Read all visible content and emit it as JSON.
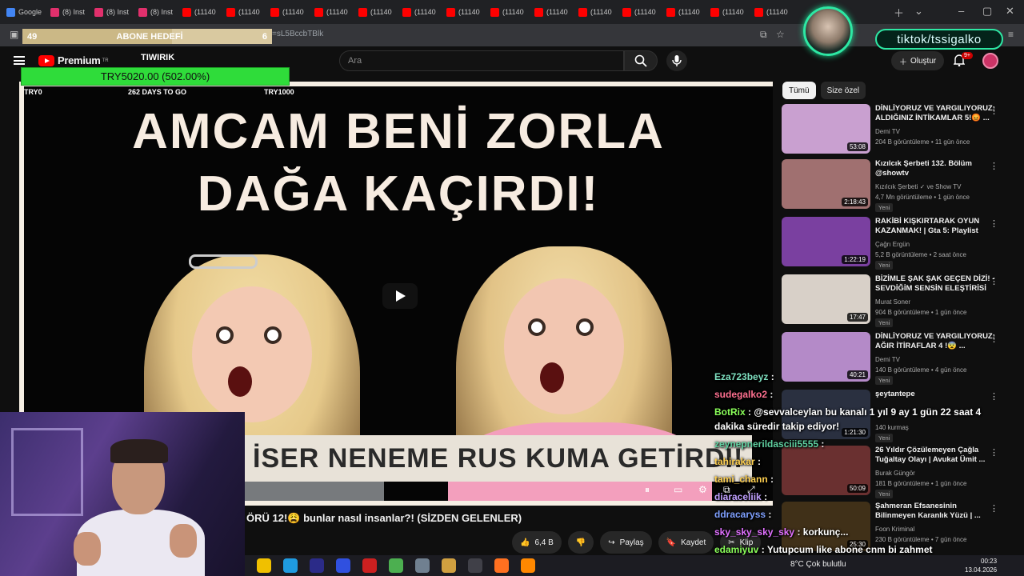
{
  "browser": {
    "tabs": [
      {
        "label": "Google",
        "color": "#4285f4"
      },
      {
        "label": "(8) Inst",
        "color": "#e1306c"
      },
      {
        "label": "(8) Inst",
        "color": "#e1306c"
      },
      {
        "label": "(8) Inst",
        "color": "#e1306c"
      },
      {
        "label": "(11140",
        "color": "#ff0000"
      },
      {
        "label": "(11140",
        "color": "#ff0000"
      },
      {
        "label": "(11140",
        "color": "#ff0000"
      },
      {
        "label": "(11140",
        "color": "#ff0000"
      },
      {
        "label": "(11140",
        "color": "#ff0000"
      },
      {
        "label": "(11140",
        "color": "#ff0000"
      },
      {
        "label": "(11140",
        "color": "#ff0000"
      },
      {
        "label": "(11140",
        "color": "#ff0000"
      },
      {
        "label": "(11140",
        "color": "#ff0000"
      },
      {
        "label": "(11140",
        "color": "#ff0000"
      },
      {
        "label": "(11140",
        "color": "#ff0000"
      },
      {
        "label": "(11140",
        "color": "#ff0000"
      },
      {
        "label": "(11140",
        "color": "#ff0000"
      },
      {
        "label": "(11140",
        "color": "#ff0000"
      }
    ],
    "url": "=sL5BccbTBlk"
  },
  "overlay": {
    "subgoal_left": "49",
    "subgoal_label": "ABONE HEDEFİ",
    "subgoal_right": "6",
    "subgoal_progress": 0.6,
    "brand": "TIWIRIK",
    "fund": "TRY5020.00 (502.00%)",
    "fund_left": "TRY0",
    "fund_days": "262 DAYS TO GO",
    "fund_right": "TRY1000",
    "tiktok": "tiktok/tssigalko"
  },
  "youtube": {
    "logo": "Premium",
    "region": "TR",
    "search_placeholder": "Ara",
    "create_label": "Oluştur",
    "notif_badge": "9+",
    "video": {
      "thumb_title_line1": "AMCAM BENİ ZORLA",
      "thumb_title_line2": "DAĞA KAÇIRDI!",
      "banner": "İSER NENEME RUS KUMA GETİRDİ!",
      "title": "ÖRÜ 12!😩 bunlar nasıl insanlar?! (SİZDEN GELENLER)",
      "likes": "6,4 B",
      "share": "Paylaş",
      "save": "Kaydet",
      "clip": "Klip"
    },
    "chips": [
      "Tümü",
      "Size özel"
    ],
    "recs": [
      {
        "title": "DİNLİYORUZ VE YARGILIYORUZ: ALDIĞINIZ İNTİKAMLAR 5!😡 ...",
        "channel": "Demi TV",
        "meta": "204 B görüntüleme • 11 gün önce",
        "duration": "53:08",
        "new": "",
        "thumb": "#c9a0d0"
      },
      {
        "title": "Kızılcık Şerbeti 132. Bölüm @showtv",
        "channel": "Kızılcık Şerbeti ✓ ve Show TV",
        "meta": "4,7 Mn görüntüleme • 1 gün önce",
        "duration": "2:18:43",
        "new": "Yeni",
        "thumb": "#a07070"
      },
      {
        "title": "RAKİBİ KIŞKIRTARAK OYUN KAZANMAK! | Gta 5: Playlist",
        "channel": "Çağrı Ergün",
        "meta": "5,2 B görüntüleme • 2 saat önce",
        "duration": "1:22:19",
        "new": "Yeni",
        "thumb": "#7a40a0"
      },
      {
        "title": "BİZİMLE ŞAK ŞAK GEÇEN DİZİ! - SEVDİĞİM SENSİN ELEŞTİRİSİ",
        "channel": "Murat Soner",
        "meta": "904 B görüntüleme • 1 gün önce",
        "duration": "17:47",
        "new": "Yeni",
        "thumb": "#d8d0c8"
      },
      {
        "title": "DİNLİYORUZ VE YARGILIYORUZ: AĞIR İTİRAFLAR 4 !😨 ...",
        "channel": "Demi TV",
        "meta": "140 B görüntüleme • 4 gün önce",
        "duration": "40:21",
        "new": "Yeni",
        "thumb": "#b48ac8"
      },
      {
        "title": "şeytantepe",
        "channel": "",
        "meta": "140 kurmaş",
        "duration": "1:21:30",
        "new": "Yeni",
        "thumb": "#2a3040"
      },
      {
        "title": "26 Yıldır Çözülemeyen Çağla Tuğaltay Olayı | Avukat Ümit ...",
        "channel": "Burak Güngör",
        "meta": "181 B görüntüleme • 1 gün önce",
        "duration": "50:09",
        "new": "Yeni",
        "thumb": "#6a3030"
      },
      {
        "title": "Şahmeran Efsanesinin Bilinmeyen Karanlık Yüzü | ...",
        "channel": "Foon Kriminal",
        "meta": "230 B görüntüleme • 7 gün önce",
        "duration": "25:30",
        "new": "",
        "thumb": "#403018"
      }
    ]
  },
  "chat": [
    {
      "user": "Eza723beyz",
      "text": ":",
      "color": "#7fe0c0"
    },
    {
      "user": "sudegalko2",
      "text": ":",
      "color": "#ff7090"
    },
    {
      "user": "BotRix",
      "text": ": @sevvalceylan bu kanalı 1 yıl 9 ay 1 gün 22 saat 4",
      "color": "#8aff5a"
    },
    {
      "user": "",
      "text": "dakika süredir takip ediyor!",
      "color": "#ffffff"
    },
    {
      "user": "zeynepnerildasciii5555",
      "text": ":",
      "color": "#5fd0a0"
    },
    {
      "user": "tahirakar",
      "text": ":",
      "color": "#ffd050"
    },
    {
      "user": "tami_chann",
      "text": ":",
      "color": "#ffd050"
    },
    {
      "user": "diaraceliik",
      "text": ":",
      "color": "#c0a0ff"
    },
    {
      "user": "ddracaryss",
      "text": ":",
      "color": "#7fa0ff"
    },
    {
      "user": "sky_sky_sky_sky",
      "text": ": korkunç...",
      "color": "#e070ff"
    },
    {
      "user": "edamiyuv",
      "text": ": Yutupcum like abone cnm bi zahmet",
      "color": "#8aff5a"
    }
  ],
  "taskbar": {
    "weather": "8°C  Çok bulutlu",
    "time": "00:23",
    "date": "13.04.2026"
  }
}
